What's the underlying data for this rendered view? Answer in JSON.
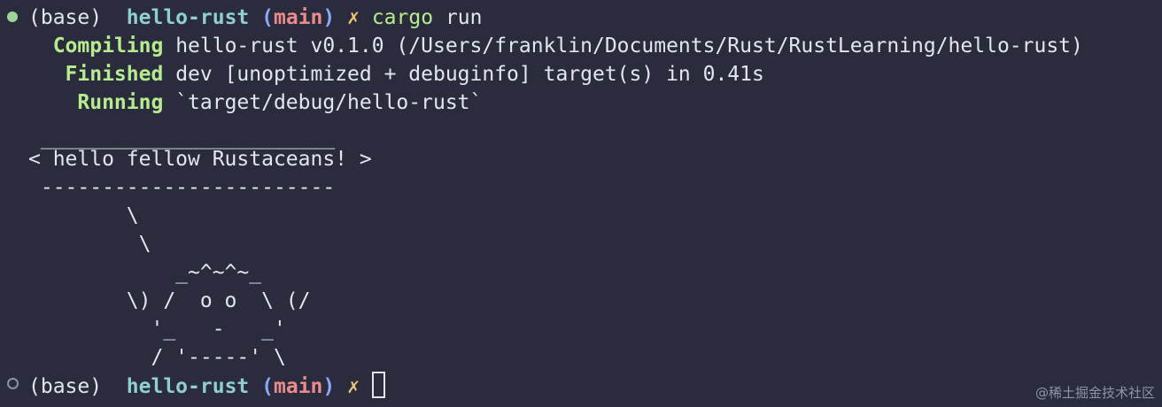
{
  "prompt1": {
    "env": "(base)",
    "dir": "hello-rust",
    "paren_open": "(",
    "branch": "main",
    "paren_close": ")",
    "symbol": "✗",
    "command": "cargo",
    "args": "run"
  },
  "output": [
    {
      "status": "Compiling",
      "message": "hello-rust v0.1.0 (/Users/franklin/Documents/Rust/RustLearning/hello-rust)"
    },
    {
      "status": "Finished",
      "message": "dev [unoptimized + debuginfo] target(s) in 0.41s"
    },
    {
      "status": "Running",
      "message": "`target/debug/hello-rust`"
    }
  ],
  "ferris": [
    " ________________________",
    "< hello fellow Rustaceans! >",
    " ------------------------",
    "        \\",
    "         \\",
    "            _~^~^~_",
    "        \\) /  o o  \\ (/",
    "          '_   -   _'",
    "          / '-----' \\"
  ],
  "prompt2": {
    "env": "(base)",
    "dir": "hello-rust",
    "paren_open": "(",
    "branch": "main",
    "paren_close": ")",
    "symbol": "✗"
  },
  "watermark": "@稀土掘金技术社区"
}
